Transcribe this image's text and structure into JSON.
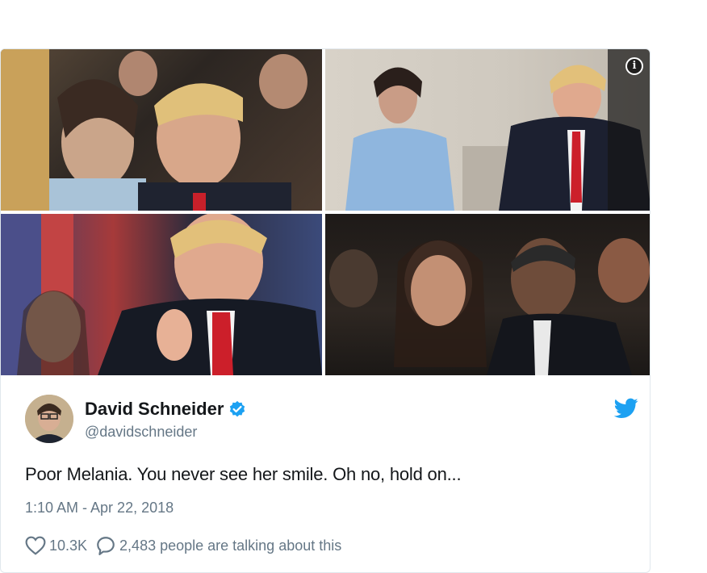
{
  "tweet": {
    "author_name": "David Schneider",
    "author_handle": "@davidschneider",
    "text": "Poor Melania. You never see her smile. Oh no, hold on...",
    "timestamp": "1:10 AM - Apr 22, 2018",
    "likes": "10.3K",
    "replies_text": "2,483 people are talking about this",
    "verified": true
  },
  "icons": {
    "info": "info-icon",
    "verified": "verified-badge-icon",
    "brand": "twitter-bird-icon",
    "like": "heart-icon",
    "reply": "speech-bubble-icon"
  },
  "colors": {
    "accent": "#1da1f2",
    "text": "#14171a",
    "muted": "#657786",
    "border": "#e1e8ed"
  }
}
